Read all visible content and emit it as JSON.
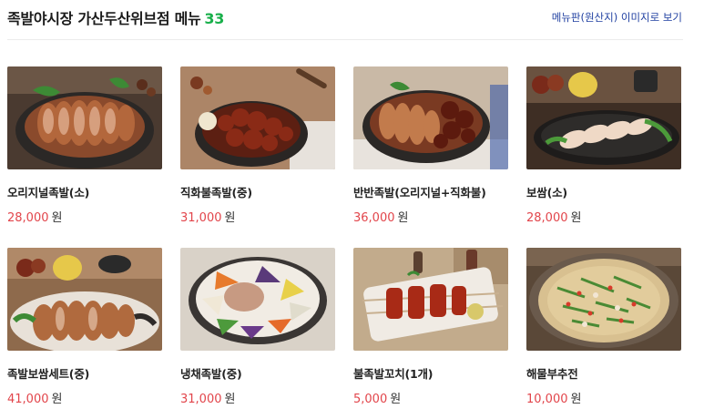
{
  "header": {
    "title": "족발야시장 가산두산위브점 메뉴",
    "count": "33",
    "menu_board_link": "메뉴판(원산지) 이미지로 보기"
  },
  "currency": "원",
  "items": [
    {
      "name": "오리지널족발(소)",
      "price": "28,000",
      "image": "original-jokbal-photo"
    },
    {
      "name": "직화불족발(중)",
      "price": "31,000",
      "image": "spicy-jokbal-photo"
    },
    {
      "name": "반반족발(오리지널+직화불)",
      "price": "36,000",
      "image": "half-half-jokbal-photo"
    },
    {
      "name": "보쌈(소)",
      "price": "28,000",
      "image": "bossam-photo"
    },
    {
      "name": "족발보쌈세트(중)",
      "price": "41,000",
      "image": "jokbal-bossam-set-photo"
    },
    {
      "name": "냉채족발(중)",
      "price": "31,000",
      "image": "cold-jokbal-salad-photo"
    },
    {
      "name": "불족발꼬치(1개)",
      "price": "5,000",
      "image": "jokbal-skewer-photo"
    },
    {
      "name": "해물부추전",
      "price": "10,000",
      "image": "seafood-pancake-photo"
    }
  ],
  "colors": {
    "count": "#19b04b",
    "price": "#e2454b",
    "link": "#1f3fa0"
  }
}
